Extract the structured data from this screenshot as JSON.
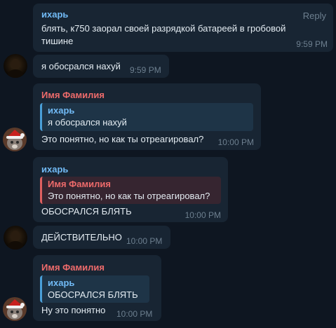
{
  "colors": {
    "background": "#0e1621",
    "bubble": "#182533",
    "sender_blue": "#71baf5",
    "sender_red": "#ee6b6b",
    "timestamp": "#6d7f8f"
  },
  "messages": [
    {
      "sender": "ихарь",
      "text_line1": "блять, к750 заорал своей разрядкой батареей в гробовой",
      "text_line2": "тишине",
      "time": "9:59 PM",
      "reply_label": "Reply"
    },
    {
      "text": "я обосрался нахуй",
      "time": "9:59 PM",
      "avatar_icon": "dark-avatar-icon"
    },
    {
      "sender": "Имя Фамилия",
      "quote_name": "ихарь",
      "quote_text": "я обосрался нахуй",
      "text": "Это понятно, но как ты отреагировал?",
      "time": "10:00 PM",
      "avatar_icon": "cat-santa-avatar-icon"
    },
    {
      "sender": "ихарь",
      "quote_name": "Имя Фамилия",
      "quote_text": "Это понятно, но как ты отреагировал?",
      "text": "ОБОСРАЛСЯ БЛЯТЬ",
      "time": "10:00 PM"
    },
    {
      "text": "ДЕЙСТВИТЕЛЬНО",
      "time": "10:00 PM",
      "avatar_icon": "dark-avatar-icon"
    },
    {
      "sender": "Имя Фамилия",
      "quote_name": "ихарь",
      "quote_text": "ОБОСРАЛСЯ БЛЯТЬ",
      "text": "Ну это понятно",
      "time": "10:00 PM",
      "avatar_icon": "cat-santa-avatar-icon"
    }
  ]
}
